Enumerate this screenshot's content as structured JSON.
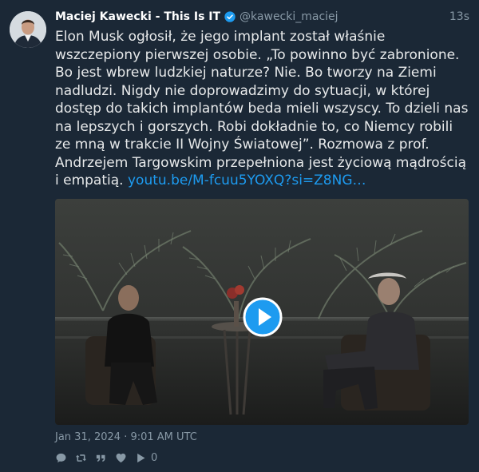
{
  "tweet": {
    "author_name": "Maciej Kawecki - This Is IT",
    "handle": "@kawecki_maciej",
    "time": "13s",
    "text": "Elon Musk ogłosił, że jego implant został właśnie wszczepiony pierwszej osobie. „To powinno być zabronione. Bo jest wbrew ludzkiej naturze? Nie. Bo tworzy na Ziemi nadludzi. Nigdy nie doprowadzimy do sytuacji, w której dostęp do takich implantów beda mieli wszyscy. To dzieli nas na lepszych i gorszych. Robi dokładnie to, co Niemcy robili ze mną w trakcie II Wojny Światowej”. Rozmowa z prof. Andrzejem Targowskim przepełniona jest życiową mądrością i empatią.",
    "link_text": "youtu.be/M-fcuu5YOXQ?si=Z8NG…",
    "date": "Jan 31, 2024 · 9:01 AM UTC",
    "views": "0"
  },
  "icons": {
    "verified": "verified-badge-icon",
    "reply": "reply-icon",
    "retweet": "retweet-icon",
    "quote": "quote-icon",
    "like": "heart-icon",
    "views": "play-views-icon",
    "play": "play-icon"
  },
  "colors": {
    "background": "#1b2836",
    "link": "#1d9bf0",
    "muted": "#8899a6",
    "play_button": "#1d9bf0"
  }
}
